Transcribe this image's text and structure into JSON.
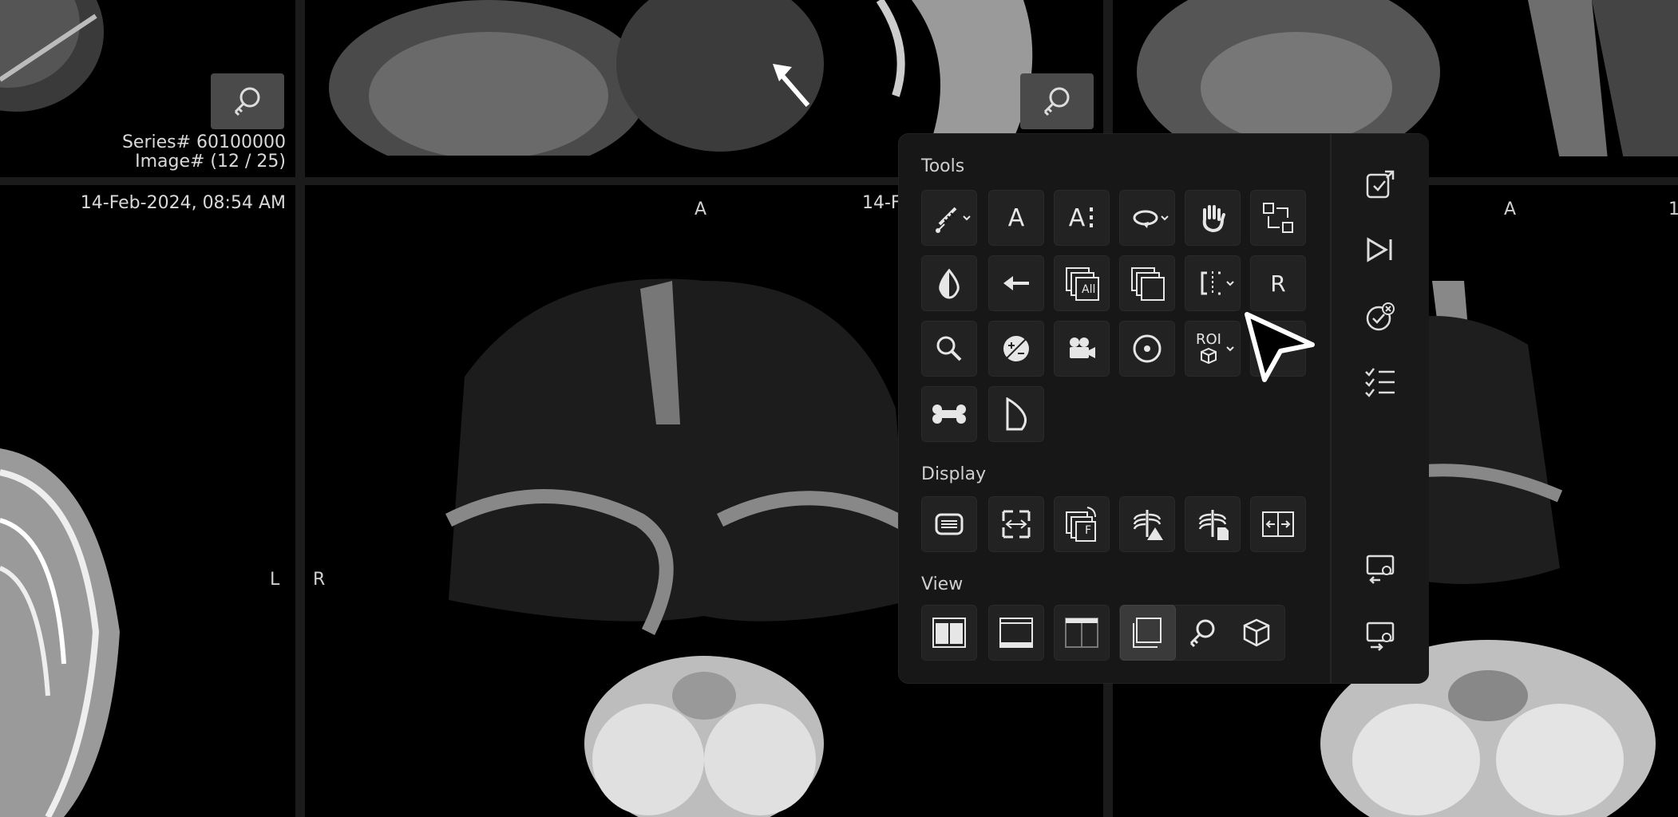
{
  "viewports": {
    "top_left": {
      "series": "Series# 60100000",
      "image": "Image# (12 / 25)"
    },
    "bottom_left": {
      "date": "14-Feb-2024, 08:54 AM",
      "orient_right": "L"
    },
    "bottom_center": {
      "orient_top": "A",
      "orient_left": "R",
      "date_partial": "14-F"
    },
    "bottom_right": {
      "orient_top": "A",
      "edge_partial": "1"
    }
  },
  "panel": {
    "sections": {
      "tools": "Tools",
      "display": "Display",
      "view": "View"
    },
    "tools": {
      "annotate_text": "A",
      "annotate_text_list": "A",
      "all_series": "All",
      "reset_label": "R",
      "roi_label": "ROI"
    },
    "display": {
      "flip_label": "F"
    }
  },
  "colors": {
    "panel_bg": "#171717",
    "tool_bg": "#222222",
    "active_bg": "#3a3a3a",
    "icon": "#e6e6e6"
  }
}
